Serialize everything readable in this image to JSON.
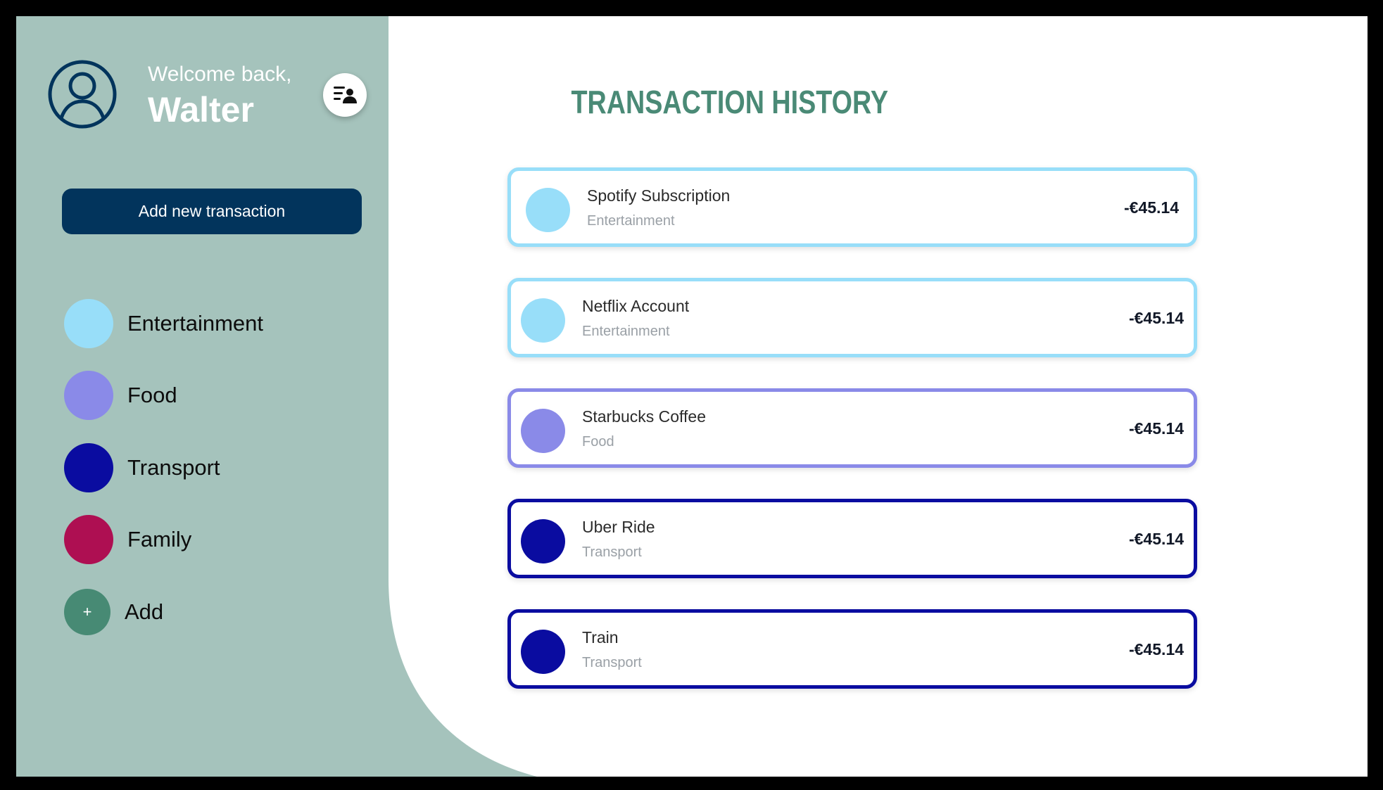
{
  "user": {
    "greeting": "Welcome back,",
    "name": "Walter"
  },
  "sidebar": {
    "add_transaction_label": "Add new transaction",
    "categories": [
      {
        "label": "Entertainment",
        "color": "#98def9"
      },
      {
        "label": "Food",
        "color": "#8a8ae8"
      },
      {
        "label": "Transport",
        "color": "#0a0ca0"
      },
      {
        "label": "Family",
        "color": "#ae0f52"
      }
    ],
    "add_category": {
      "label": "Add",
      "icon": "+",
      "color": "#478a74"
    }
  },
  "colors": {
    "sidebar_bg": "#a5c3bc",
    "primary": "#02345c",
    "title": "#4a8a76"
  },
  "main": {
    "title": "TRANSACTION HISTORY",
    "transactions": [
      {
        "name": "Spotify Subscription",
        "category": "Entertainment",
        "amount": "-€45.14",
        "color": "#98def9"
      },
      {
        "name": "Netflix Account",
        "category": "Entertainment",
        "amount": "-€45.14",
        "color": "#98def9"
      },
      {
        "name": "Starbucks Coffee",
        "category": "Food",
        "amount": "-€45.14",
        "color": "#8a8ae8"
      },
      {
        "name": "Uber Ride",
        "category": "Transport",
        "amount": "-€45.14",
        "color": "#0a0ca0"
      },
      {
        "name": "Train",
        "category": "Transport",
        "amount": "-€45.14",
        "color": "#0a0ca0"
      }
    ]
  }
}
